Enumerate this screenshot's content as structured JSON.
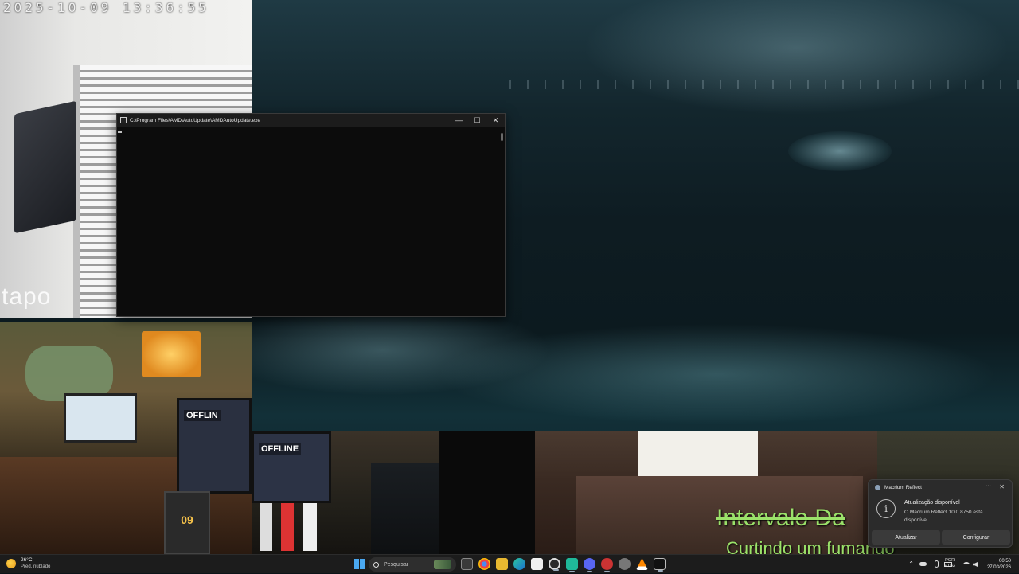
{
  "camera_feed": {
    "timestamp": "2025-10-09  13:36:55",
    "logo": "tapo"
  },
  "stream_overlays": {
    "offline_badge_1": "OFFLIN",
    "offline_badge_2": "OFFLINE",
    "calendar_day": "09",
    "overlay_title": "Intervalo Da",
    "overlay_subtitle": "Curtindo um fumando"
  },
  "console_window": {
    "title": "C:\\Program Files\\AMD\\AutoUpdate\\AMDAutoUpdate.exe",
    "minimize": "—",
    "maximize": "☐",
    "close": "✕"
  },
  "notification": {
    "app_name": "Macrium Reflect",
    "more": "···",
    "close": "✕",
    "info_icon": "i",
    "title": "Atualização disponível",
    "message": "O Macrium Reflect 10.0.8750 está disponível.",
    "button_update": "Atualizar",
    "button_configure": "Configurar"
  },
  "taskbar": {
    "weather_temp": "26°C",
    "weather_desc": "Pred. nublado",
    "search_placeholder": "Pesquisar",
    "apps": [
      "file-explorer-icon",
      "chrome-icon",
      "folder-icon",
      "edge-icon",
      "store-icon",
      "obs-icon",
      "app-icon",
      "discord-icon",
      "media-icon",
      "settings-icon",
      "vlc-icon",
      "terminal-icon"
    ],
    "tray_chevron": "⌃",
    "lang_line1": "POR",
    "lang_line2": "PTB2",
    "time": "00:50",
    "date": "27/03/2026"
  },
  "colors": {
    "overlay_text": "#9be26a",
    "taskbar_bg": "#1c1c1c",
    "toast_bg": "#2b2b2b"
  }
}
